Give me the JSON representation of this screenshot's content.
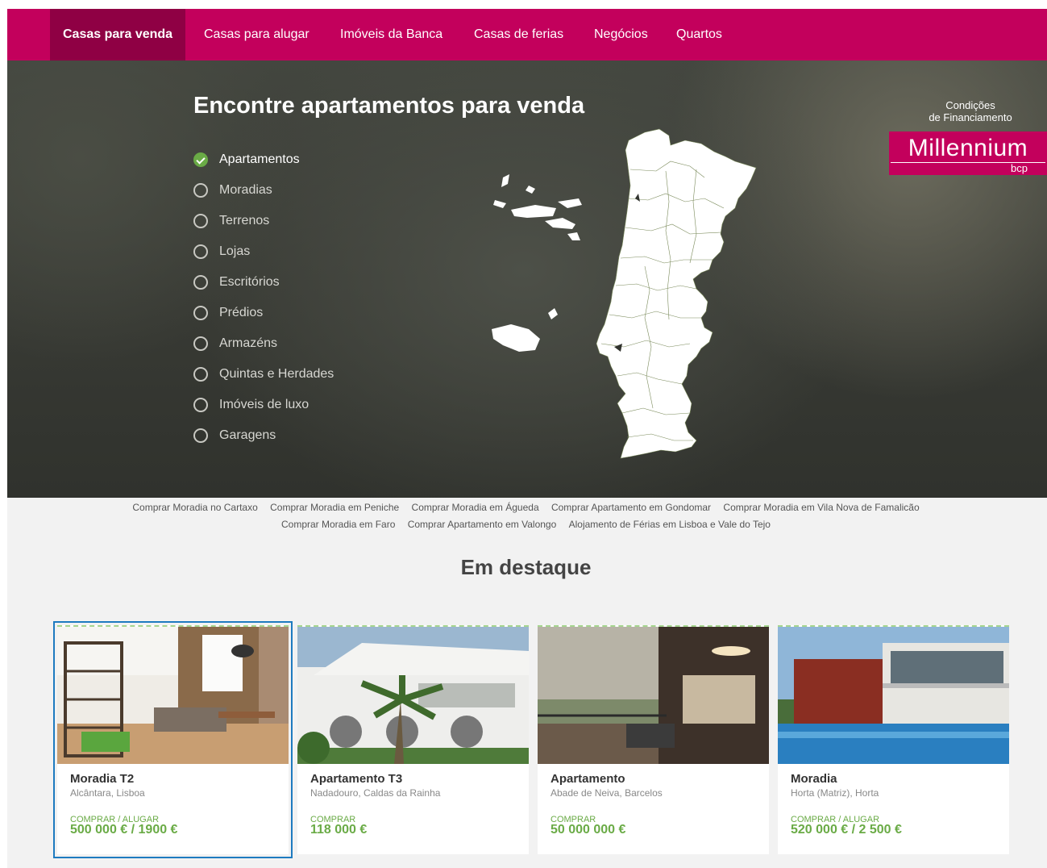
{
  "nav": {
    "tabs": [
      {
        "label": "Casas para venda"
      },
      {
        "label": "Casas para alugar"
      },
      {
        "label": "Imóveis da Banca"
      },
      {
        "label": "Casas de ferias"
      },
      {
        "label": "Negócios"
      },
      {
        "label": "Quartos"
      }
    ]
  },
  "hero": {
    "title": "Encontre apartamentos para venda",
    "types": [
      {
        "label": "Apartamentos"
      },
      {
        "label": "Moradias"
      },
      {
        "label": "Terrenos"
      },
      {
        "label": "Lojas"
      },
      {
        "label": "Escritórios"
      },
      {
        "label": "Prédios"
      },
      {
        "label": "Armazéns"
      },
      {
        "label": "Quintas e Herdades"
      },
      {
        "label": "Imóveis de luxo"
      },
      {
        "label": "Garagens"
      }
    ],
    "finance": {
      "line1": "Condições",
      "line2": "de Financiamento",
      "logo_name": "Millennium",
      "logo_sub": "bcp"
    }
  },
  "quick_links": [
    "Comprar Moradia no Cartaxo",
    "Comprar Moradia em Peniche",
    "Comprar Moradia em Águeda",
    "Comprar Apartamento em Gondomar",
    "Comprar Moradia em Vila Nova de Famalicão",
    "Comprar Moradia em Faro",
    "Comprar Apartamento em Valongo",
    "Alojamento de Férias em Lisboa e Vale do Tejo"
  ],
  "featured": {
    "title": "Em destaque",
    "cards": [
      {
        "title": "Moradia T2",
        "location": "Alcântara, Lisboa",
        "operation": "COMPRAR / ALUGAR",
        "price": "500 000 € / 1900 €"
      },
      {
        "title": "Apartamento T3",
        "location": "Nadadouro, Caldas da Rainha",
        "operation": "COMPRAR",
        "price": "118 000 €"
      },
      {
        "title": "Apartamento",
        "location": "Abade de Neiva, Barcelos",
        "operation": "COMPRAR",
        "price": "50 000 000 €"
      },
      {
        "title": "Moradia",
        "location": "Horta (Matriz), Horta",
        "operation": "COMPRAR / ALUGAR",
        "price": "520 000 € / 2 500 €"
      }
    ]
  },
  "colors": {
    "brand": "#c3005c",
    "brand_active": "#8f0044",
    "accent_green": "#6aab46",
    "selected_outline": "#1e7bc0"
  }
}
